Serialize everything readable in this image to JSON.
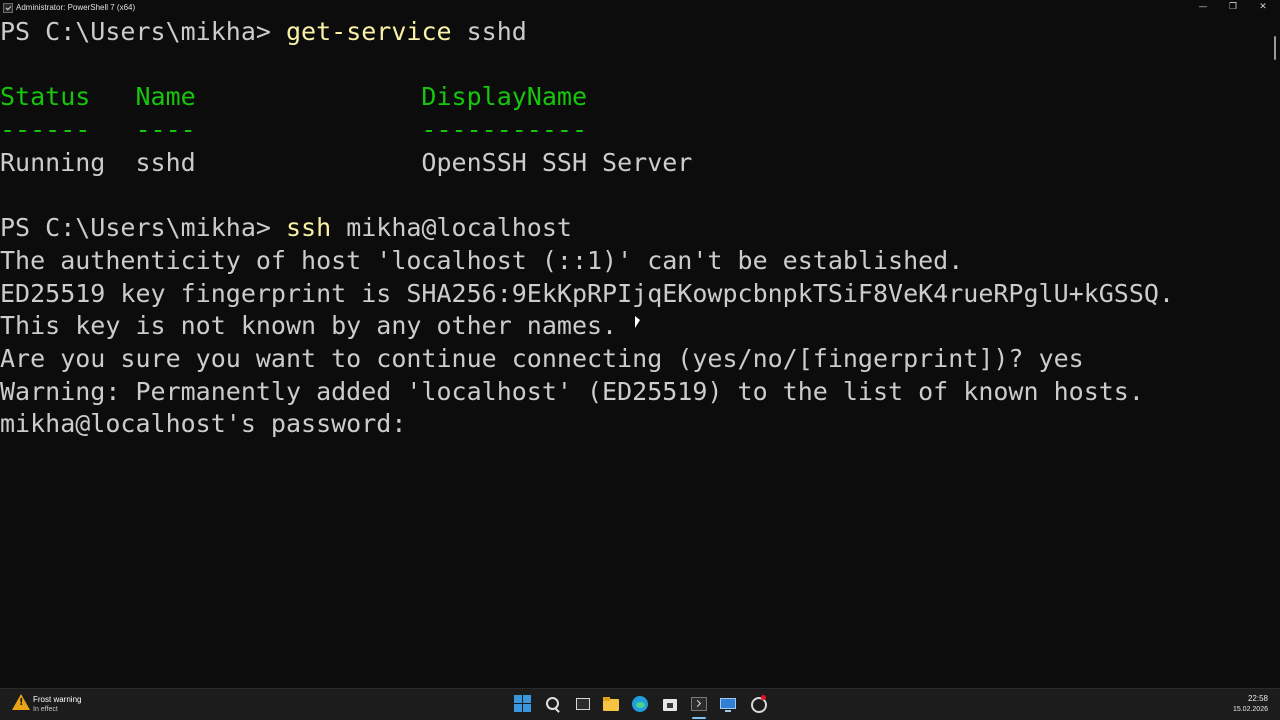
{
  "window": {
    "title": "Administrator: PowerShell 7 (x64)",
    "minimize_glyph": "—",
    "maximize_glyph": "❐",
    "close_glyph": "✕"
  },
  "terminal": {
    "lines": [
      {
        "segments": [
          {
            "text": "PS C:\\Users\\mikha> ",
            "style": "prompt"
          },
          {
            "text": "get-service",
            "style": "cmd"
          },
          {
            "text": " sshd",
            "style": "arg"
          }
        ]
      },
      {
        "segments": []
      },
      {
        "segments": [
          {
            "text": "Status   Name               DisplayName",
            "style": "hdr"
          }
        ]
      },
      {
        "segments": [
          {
            "text": "------   ----               -----------",
            "style": "hdr"
          }
        ]
      },
      {
        "segments": [
          {
            "text": "Running  sshd               OpenSSH SSH Server",
            "style": "arg"
          }
        ]
      },
      {
        "segments": []
      },
      {
        "segments": [
          {
            "text": "PS C:\\Users\\mikha> ",
            "style": "prompt"
          },
          {
            "text": "ssh",
            "style": "cmd"
          },
          {
            "text": " mikha@localhost",
            "style": "arg"
          }
        ]
      },
      {
        "segments": [
          {
            "text": "The authenticity of host 'localhost (::1)' can't be established.",
            "style": "arg"
          }
        ]
      },
      {
        "segments": [
          {
            "text": "ED25519 key fingerprint is SHA256:9EkKpRPIjqEKowpcbnpkTSiF8VeK4rueRPglU+kGSSQ.",
            "style": "arg"
          }
        ]
      },
      {
        "segments": [
          {
            "text": "This key is not known by any other names.",
            "style": "arg"
          }
        ]
      },
      {
        "segments": [
          {
            "text": "Are you sure you want to continue connecting (yes/no/[fingerprint])? yes",
            "style": "arg"
          }
        ]
      },
      {
        "segments": [
          {
            "text": "Warning: Permanently added 'localhost' (ED25519) to the list of known hosts.",
            "style": "arg"
          }
        ]
      },
      {
        "segments": [
          {
            "text": "mikha@localhost's password:",
            "style": "arg"
          }
        ]
      }
    ]
  },
  "taskbar": {
    "weather": {
      "title": "Frost warning",
      "subtitle": "In effect",
      "icon": "warning-icon"
    },
    "apps": [
      {
        "name": "start-icon"
      },
      {
        "name": "search-icon"
      },
      {
        "name": "task-view-icon"
      },
      {
        "name": "file-explorer-icon"
      },
      {
        "name": "edge-icon"
      },
      {
        "name": "store-icon"
      },
      {
        "name": "terminal-icon",
        "active": true
      },
      {
        "name": "remote-desktop-icon"
      },
      {
        "name": "app-icon"
      }
    ],
    "clock": {
      "time": "22:58",
      "date": "15.02.2026"
    }
  },
  "colors": {
    "background": "#0c0c0c",
    "text": "#cccccc",
    "command": "#f9f1a5",
    "table_header": "#16c60c",
    "taskbar": "#1c1c1c"
  }
}
